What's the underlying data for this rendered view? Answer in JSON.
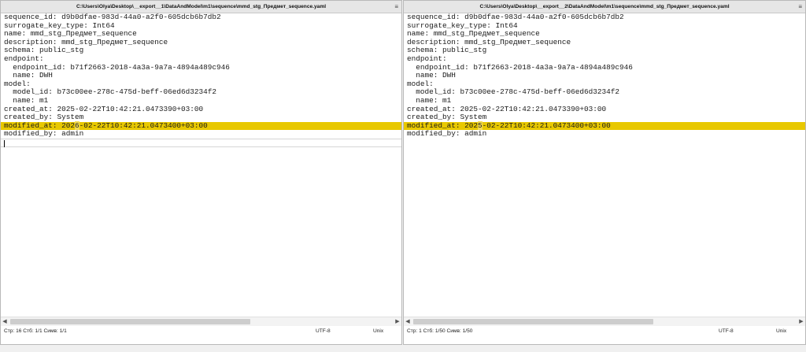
{
  "left_pane": {
    "title": "C:\\Users\\Olya\\Desktop\\__export__1\\DataAndModel\\m1\\sequence\\mmd_stg_Предмет_sequence.yaml",
    "menu_icon": "hamburger-menu-icon",
    "lines": [
      {
        "text": "sequence_id: d9b0dfae-983d-44a0-a2f0-605dcb6b7db2"
      },
      {
        "text": "surrogate_key_type: Int64"
      },
      {
        "text": "name: mmd_stg_Предмет_sequence"
      },
      {
        "text": "description: mmd_stg_Предмет_sequence"
      },
      {
        "text": "schema: public_stg"
      },
      {
        "text": "endpoint:"
      },
      {
        "text": "  endpoint_id: b71f2663-2018-4a3a-9a7a-4894a489c946"
      },
      {
        "text": "  name: DWH"
      },
      {
        "text": "model:"
      },
      {
        "text": "  model_id: b73c00ee-278c-475d-beff-06ed6d3234f2"
      },
      {
        "text": "  name: m1"
      },
      {
        "text": "created_at: 2025-02-22T10:42:21.0473390+03:00"
      },
      {
        "text": "created_by: System"
      },
      {
        "text": "modified_at: 2026-02-22T10:42:21.0473400+03:00",
        "highlight": true,
        "pre": "modified_at: 202",
        "diff": "6",
        "post": "-02-22T10:42:21.0473400+03:00"
      },
      {
        "text": "modified_by: admin"
      },
      {
        "text": "",
        "cursor": true
      }
    ],
    "status": {
      "position": "Стр: 16  Стб: 1/1  Симв: 1/1",
      "encoding": "UTF-8",
      "eol": "Unix"
    }
  },
  "right_pane": {
    "title": "C:\\Users\\Olya\\Desktop\\__export__2\\DataAndModel\\m1\\sequence\\mmd_stg_Предмет_sequence.yaml",
    "menu_icon": "hamburger-menu-icon",
    "lines": [
      {
        "text": "sequence_id: d9b0dfae-983d-44a0-a2f0-605dcb6b7db2"
      },
      {
        "text": "surrogate_key_type: Int64"
      },
      {
        "text": "name: mmd_stg_Предмет_sequence"
      },
      {
        "text": "description: mmd_stg_Предмет_sequence"
      },
      {
        "text": "schema: public_stg"
      },
      {
        "text": "endpoint:"
      },
      {
        "text": "  endpoint_id: b71f2663-2018-4a3a-9a7a-4894a489c946"
      },
      {
        "text": "  name: DWH"
      },
      {
        "text": "model:"
      },
      {
        "text": "  model_id: b73c00ee-278c-475d-beff-06ed6d3234f2"
      },
      {
        "text": "  name: m1"
      },
      {
        "text": "created_at: 2025-02-22T10:42:21.0473390+03:00"
      },
      {
        "text": "created_by: System"
      },
      {
        "text": "modified_at: 2025-02-22T10:42:21.0473400+03:00",
        "highlight": true,
        "pre": "modified_at: 202",
        "diff": "5",
        "post": "-02-22T10:42:21.0473400+03:00"
      },
      {
        "text": "modified_by: admin"
      }
    ],
    "status": {
      "position": "Стр: 1  Стб: 1/50  Симв: 1/50",
      "encoding": "UTF-8",
      "eol": "Unix"
    }
  },
  "colors": {
    "diff_line": "#e8c800",
    "diff_char": "#f2db55"
  }
}
